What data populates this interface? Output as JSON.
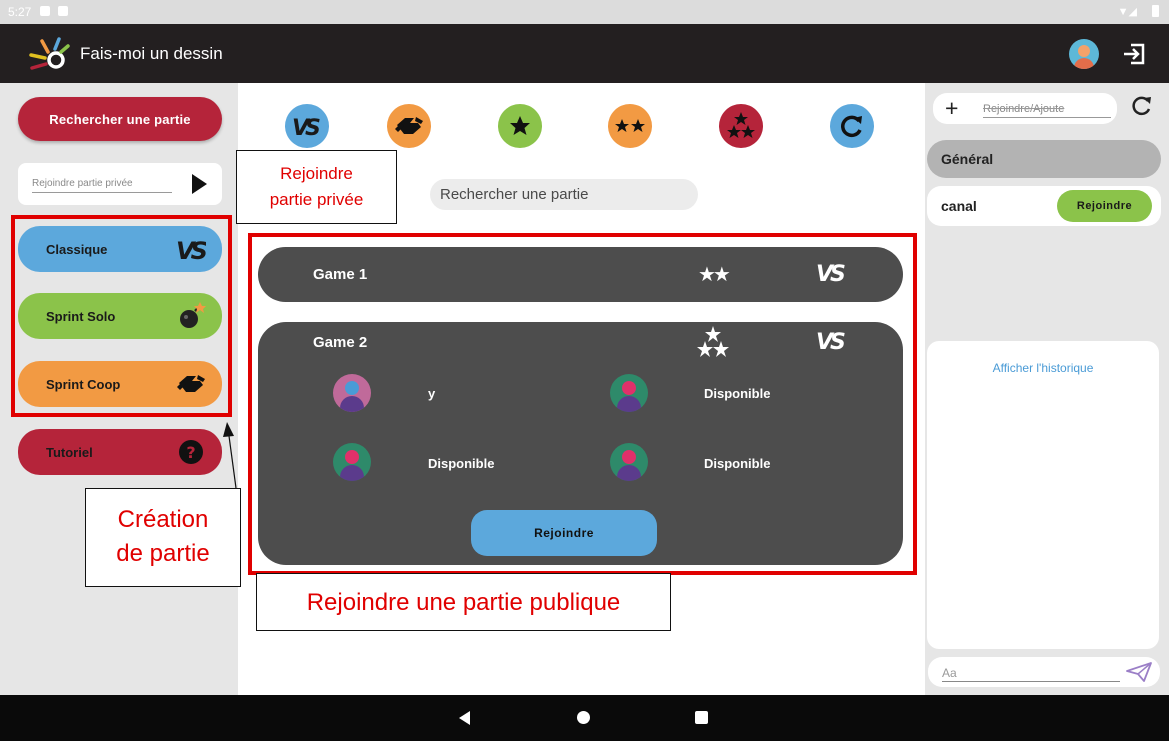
{
  "status_bar": {
    "time": "5:27"
  },
  "app": {
    "title": "Fais-moi un dessin"
  },
  "left_panel": {
    "search_button": "Rechercher une partie",
    "private_join_placeholder": "Rejoindre partie privée",
    "modes": [
      {
        "label": "Classique",
        "icon": "vs-icon"
      },
      {
        "label": "Sprint Solo",
        "icon": "bomb-icon"
      },
      {
        "label": "Sprint Coop",
        "icon": "handshake-icon"
      },
      {
        "label": "Tutoriel",
        "icon": "help-icon"
      }
    ]
  },
  "center": {
    "filters": [
      {
        "icon": "vs-icon",
        "color": "#5ca8dc"
      },
      {
        "icon": "handshake-icon",
        "color": "#f29a43"
      },
      {
        "icon": "one-star-icon",
        "color": "#8bc34a"
      },
      {
        "icon": "two-stars-icon",
        "color": "#f29a43"
      },
      {
        "icon": "three-stars-icon",
        "color": "#b5243a"
      },
      {
        "icon": "refresh-icon",
        "color": "#5ca8dc"
      }
    ],
    "search_placeholder": "Rechercher une partie",
    "games": [
      {
        "name": "Game 1",
        "stars": "★★",
        "mode": "VS"
      },
      {
        "name": "Game 2",
        "stars": "3",
        "mode": "VS",
        "players": [
          {
            "name": "y"
          },
          {
            "name": "Disponible"
          },
          {
            "name": "Disponible"
          },
          {
            "name": "Disponible"
          }
        ],
        "join_button": "Rejoindre"
      }
    ]
  },
  "right_panel": {
    "channel_input_placeholder": "Rejoindre/Ajoute",
    "channels": [
      {
        "name": "Général"
      },
      {
        "name": "canal",
        "join_label": "Rejoindre"
      }
    ],
    "history_link": "Afficher l'historique",
    "message_placeholder": "Aa"
  },
  "annotations": {
    "private_note": [
      "Rejoindre",
      "partie privée"
    ],
    "creation_note": [
      "Création",
      "de partie"
    ],
    "public_note": "Rejoindre une partie publique"
  },
  "colors": {
    "brand_red": "#b5243a",
    "blue": "#5ca8dc",
    "green": "#8bc34a",
    "orange": "#f29a43",
    "annotation_red": "#e00000"
  }
}
